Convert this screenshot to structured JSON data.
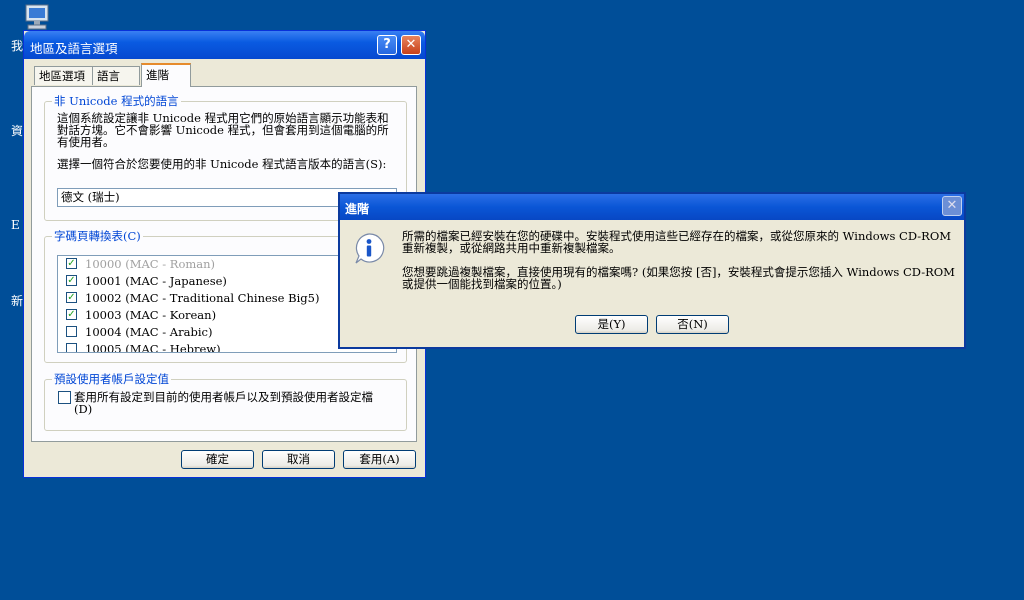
{
  "desktop": {
    "fragments": [
      "我",
      "資",
      "E",
      "新"
    ]
  },
  "main_window": {
    "title": "地區及語言選項",
    "help_glyph": "?",
    "close_glyph": "✕",
    "tabs": [
      "地區選項",
      "語言",
      "進階"
    ],
    "non_unicode": {
      "legend": "非 Unicode 程式的語言",
      "description_lines": [
        "這個系統設定讓非 Unicode 程式用它們的原始語言顯示功能表和",
        "對話方塊。它不會影響 Unicode 程式，但會套用到這個電腦的所",
        "有使用者。"
      ],
      "select_label": "選擇一個符合於您要使用的非 Unicode 程式語言版本的語言(S):",
      "selected_language": "德文 (瑞士)"
    },
    "codepage": {
      "legend": "字碼頁轉換表(C)",
      "items": [
        {
          "label": "10000 (MAC - Roman)",
          "checked": true,
          "disabled": true
        },
        {
          "label": "10001 (MAC - Japanese)",
          "checked": true,
          "disabled": false
        },
        {
          "label": "10002 (MAC - Traditional Chinese Big5)",
          "checked": true,
          "disabled": false
        },
        {
          "label": "10003 (MAC - Korean)",
          "checked": true,
          "disabled": false
        },
        {
          "label": "10004 (MAC - Arabic)",
          "checked": false,
          "disabled": false
        },
        {
          "label": "10005 (MAC - Hebrew)",
          "checked": false,
          "disabled": false
        }
      ]
    },
    "default_user": {
      "legend": "預設使用者帳戶設定值",
      "checkbox_line1": "套用所有設定到目前的使用者帳戶以及到預設使用者設定檔",
      "checkbox_line2": "(D)"
    },
    "buttons": {
      "ok": "確定",
      "cancel": "取消",
      "apply": "套用(A)"
    }
  },
  "message_dialog": {
    "title": "進階",
    "close_glyph": "✕",
    "icon": "info-icon",
    "message1_lines": [
      "所需的檔案已經安裝在您的硬碟中。安裝程式使用這些已經存在的檔案，或從您原來的 Windows CD-ROM",
      "重新複製，或從網路共用中重新複製檔案。"
    ],
    "message2_lines": [
      "您想要跳過複製檔案，直接使用現有的檔案嗎? (如果您按 [否]，安裝程式會提示您插入 Windows CD-ROM",
      "或提供一個能找到檔案的位置。)"
    ],
    "buttons": {
      "yes": "是(Y)",
      "no": "否(N)"
    }
  },
  "colors": {
    "desktop": "#004e98",
    "titlebar": "#0a5be1",
    "dialog_face": "#ece9d8",
    "group_label": "#0046d5"
  }
}
